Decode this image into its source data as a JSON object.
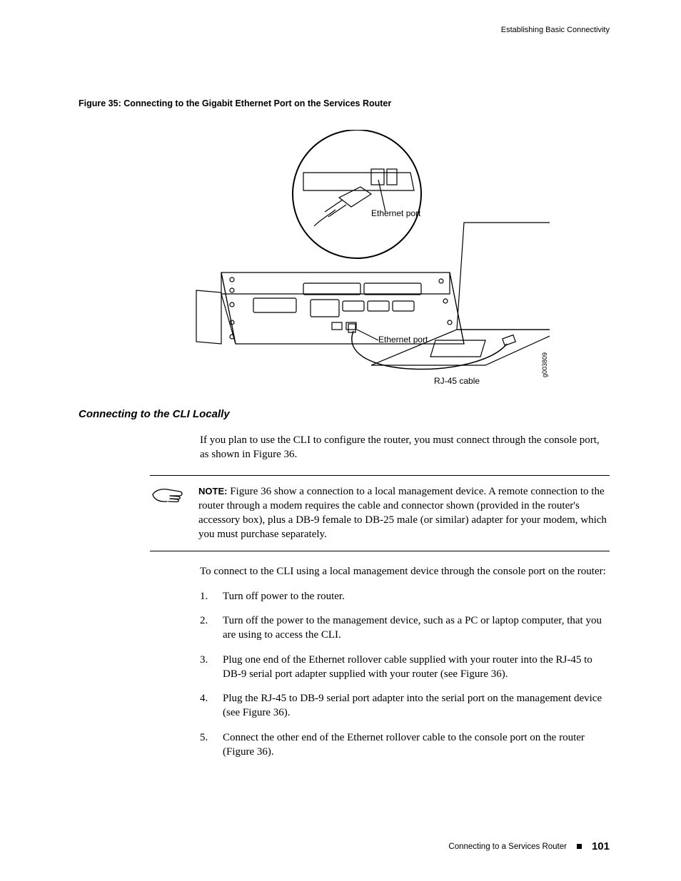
{
  "running_head": "Establishing Basic Connectivity",
  "figure_caption": "Figure 35: Connecting to the Gigabit Ethernet Port on the Services Router",
  "figure_labels": {
    "eport1": "Ethernet port",
    "eport2": "Ethernet port",
    "rj45": "RJ-45 cable",
    "gcode": "g003809"
  },
  "heading": "Connecting to the CLI Locally",
  "intro": "If you plan to use the CLI to configure the router, you must connect through the console port, as shown in Figure 36.",
  "note_label": "NOTE:",
  "note": " Figure 36 show a connection to a local management device. A remote connection to the router through a modem requires the cable and connector shown (provided in the router's accessory box), plus a DB-9 female to DB-25 male (or similar) adapter for your modem, which you must purchase separately.",
  "lead_in": "To connect to the CLI using a local management device through the console port on the router:",
  "steps": [
    "Turn off power to the router.",
    "Turn off the power to the management device, such as a PC or laptop computer, that you are using to access the CLI.",
    "Plug one end of the Ethernet rollover cable supplied with your router into the RJ-45 to DB-9 serial port adapter supplied with your router (see Figure 36).",
    "Plug the RJ-45 to DB-9 serial port adapter into the serial port on the management device (see Figure 36).",
    "Connect the other end of the Ethernet rollover cable to the console port on the router (Figure 36)."
  ],
  "footer_text": "Connecting to a Services Router",
  "page_number": "101"
}
